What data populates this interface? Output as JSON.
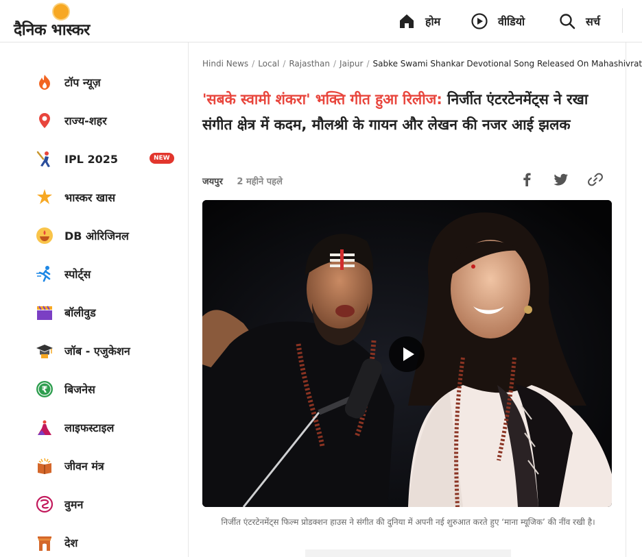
{
  "header": {
    "logo_text": "दैनिक भास्कर",
    "nav": [
      {
        "label": "होम",
        "icon": "home-icon"
      },
      {
        "label": "वीडियो",
        "icon": "play-circle-icon"
      },
      {
        "label": "सर्च",
        "icon": "search-icon"
      }
    ]
  },
  "sidebar": {
    "items": [
      {
        "label": "टॉप न्यूज़",
        "icon": "flame-icon"
      },
      {
        "label": "राज्य-शहर",
        "icon": "location-pin-icon"
      },
      {
        "label": "IPL 2025",
        "icon": "cricket-player-icon",
        "badge": "NEW"
      },
      {
        "label": "भास्कर खास",
        "icon": "star-burst-icon"
      },
      {
        "label": "DB ओरिजिनल",
        "icon": "diya-icon"
      },
      {
        "label": "स्पोर्ट्स",
        "icon": "running-person-icon"
      },
      {
        "label": "बॉलीवुड",
        "icon": "clapperboard-icon"
      },
      {
        "label": "जॉब - एजुकेशन",
        "icon": "graduation-cap-icon"
      },
      {
        "label": "बिजनेस",
        "icon": "rupee-coin-icon"
      },
      {
        "label": "लाइफस्टाइल",
        "icon": "dress-icon"
      },
      {
        "label": "जीवन मंत्र",
        "icon": "book-icon"
      },
      {
        "label": "वुमन",
        "icon": "woman-logo-icon"
      },
      {
        "label": "देश",
        "icon": "india-gate-icon"
      }
    ]
  },
  "article": {
    "breadcrumb": [
      "Hindi News",
      "Local",
      "Rajasthan",
      "Jaipur",
      "Sabke Swami Shankar Devotional Song Released On Mahashivratri"
    ],
    "headline_highlight": "'सबके स्वामी शंकरा' भक्ति गीत हुआ रिलीज:",
    "headline_rest": " निर्जीत एंटरटेनमेंट्स ने रखा संगीत क्षेत्र में कदम, मौलश्री के गायन और लेखन की नजर आई झलक",
    "city": "जयपुर",
    "time": "2 महीने पहले",
    "caption": "निर्जीत एंटरटेनमेंट्स फिल्म प्रोडक्शन हाउस ने संगीत की दुनिया में अपनी नई शुरुआत करते हुए ‘माना म्यूजिक’ की नींव रखी है।"
  },
  "colors": {
    "accent_red": "#e8453c",
    "logo_sun": "#f7a823",
    "new_badge": "#e2362d"
  }
}
